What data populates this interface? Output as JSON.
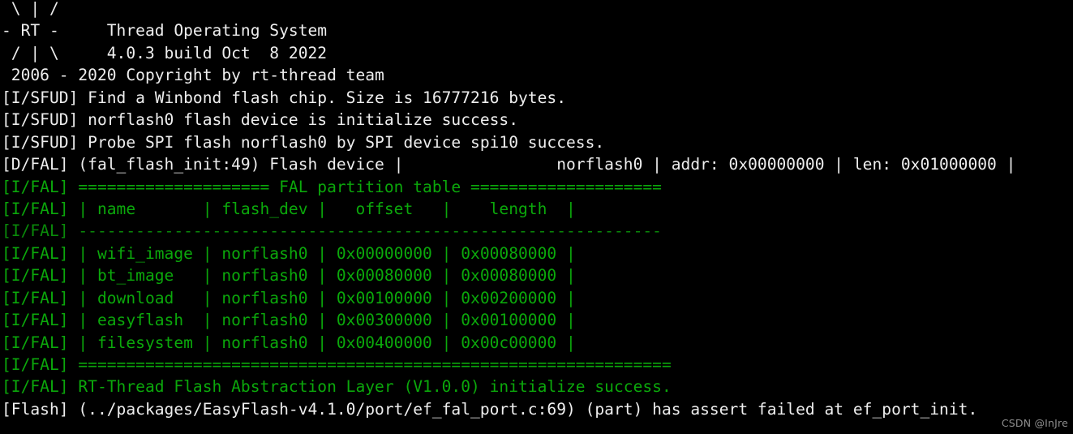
{
  "terminal": {
    "background_color": "#000000",
    "foreground_color": "#eeeeee",
    "green_color": "#0ba80b",
    "banner": {
      "line1": " \\ | /",
      "line2": "- RT -     Thread Operating System",
      "line3": " / | \\     4.0.3 build Oct  8 2022",
      "line4": " 2006 - 2020 Copyright by rt-thread team"
    },
    "log_lines": [
      {
        "tag": "[I/SFUD]",
        "color": "white",
        "text": "[I/SFUD] Find a Winbond flash chip. Size is 16777216 bytes."
      },
      {
        "tag": "[I/SFUD]",
        "color": "white",
        "text": "[I/SFUD] norflash0 flash device is initialize success."
      },
      {
        "tag": "[I/SFUD]",
        "color": "white",
        "text": "[I/SFUD] Probe SPI flash norflash0 by SPI device spi10 success."
      },
      {
        "tag": "[D/FAL]",
        "color": "white",
        "text": "[D/FAL] (fal_flash_init:49) Flash device |                norflash0 | addr: 0x00000000 | len: 0x01000000 |"
      },
      {
        "tag": "[I/FAL]",
        "color": "green",
        "text": "[I/FAL] ==================== FAL partition table ===================="
      },
      {
        "tag": "[I/FAL]",
        "color": "green",
        "text": "[I/FAL] | name       | flash_dev |   offset   |    length  |"
      },
      {
        "tag": "[I/FAL]",
        "color": "dim",
        "text": "[I/FAL] -------------------------------------------------------------"
      },
      {
        "tag": "[I/FAL]",
        "color": "green",
        "text": "[I/FAL] | wifi_image | norflash0 | 0x00000000 | 0x00080000 |"
      },
      {
        "tag": "[I/FAL]",
        "color": "green",
        "text": "[I/FAL] | bt_image   | norflash0 | 0x00080000 | 0x00080000 |"
      },
      {
        "tag": "[I/FAL]",
        "color": "green",
        "text": "[I/FAL] | download   | norflash0 | 0x00100000 | 0x00200000 |"
      },
      {
        "tag": "[I/FAL]",
        "color": "green",
        "text": "[I/FAL] | easyflash  | norflash0 | 0x00300000 | 0x00100000 |"
      },
      {
        "tag": "[I/FAL]",
        "color": "green",
        "text": "[I/FAL] | filesystem | norflash0 | 0x00400000 | 0x00c00000 |"
      },
      {
        "tag": "[I/FAL]",
        "color": "green",
        "text": "[I/FAL] =============================================================="
      },
      {
        "tag": "[I/FAL]",
        "color": "green",
        "text": "[I/FAL] RT-Thread Flash Abstraction Layer (V1.0.0) initialize success."
      },
      {
        "tag": "[Flash]",
        "color": "white",
        "text": "[Flash] (../packages/EasyFlash-v4.1.0/port/ef_fal_port.c:69) (part) has assert failed at ef_port_init."
      }
    ],
    "partition_table": {
      "title": "FAL partition table",
      "columns": [
        "name",
        "flash_dev",
        "offset",
        "length"
      ],
      "rows": [
        {
          "name": "wifi_image",
          "flash_dev": "norflash0",
          "offset": "0x00000000",
          "length": "0x00080000"
        },
        {
          "name": "bt_image",
          "flash_dev": "norflash0",
          "offset": "0x00080000",
          "length": "0x00080000"
        },
        {
          "name": "download",
          "flash_dev": "norflash0",
          "offset": "0x00100000",
          "length": "0x00200000"
        },
        {
          "name": "easyflash",
          "flash_dev": "norflash0",
          "offset": "0x00300000",
          "length": "0x00100000"
        },
        {
          "name": "filesystem",
          "flash_dev": "norflash0",
          "offset": "0x00400000",
          "length": "0x00c00000"
        }
      ]
    },
    "flash_device": {
      "name": "norflash0",
      "addr": "0x00000000",
      "len": "0x01000000",
      "chip_vendor": "Winbond",
      "chip_size_bytes": "16777216",
      "spi_device": "spi10"
    },
    "os_info": {
      "name": "RT-Thread Operating System",
      "version": "4.0.3",
      "build_date": "Oct  8 2022",
      "copyright": "2006 - 2020 Copyright by rt-thread team"
    },
    "fal_version": "V1.0.0",
    "assert": {
      "source": "../packages/EasyFlash-v4.1.0/port/ef_fal_port.c:69",
      "symbol": "(part)",
      "function": "ef_port_init"
    }
  },
  "watermark": {
    "text": "CSDN @InJre"
  }
}
